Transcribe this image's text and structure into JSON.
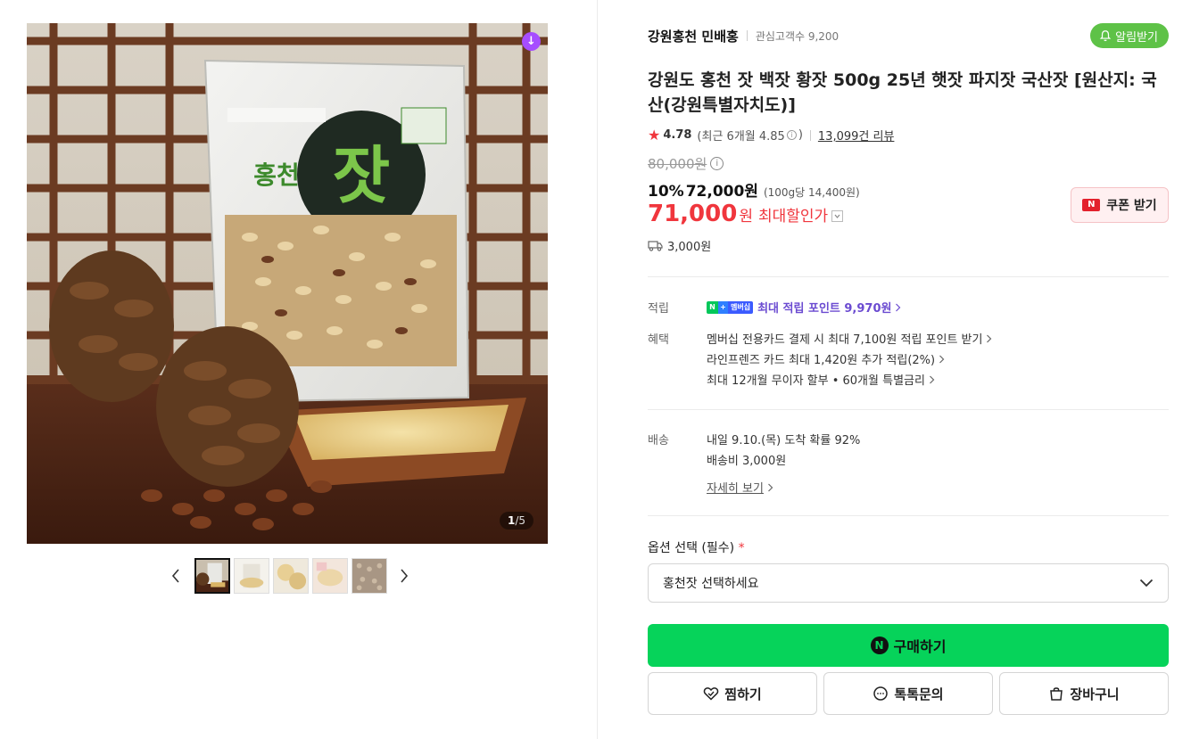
{
  "gallery": {
    "download_icon": "download-arrow-icon",
    "counter_current": "1",
    "counter_total": "/5",
    "thumbnails": [
      "thumb-1",
      "thumb-2",
      "thumb-3",
      "thumb-4",
      "thumb-5"
    ]
  },
  "seller": {
    "name": "강원홍천 민배홍",
    "followers": "관심고객수 9,200",
    "alarm_label": "알림받기"
  },
  "product": {
    "title": "강원도 홍천 잣 백잣 황잣 500g 25년 햇잣 파지잣 국산잣 [원산지: 국산(강원특별자치도)]",
    "rating": "4.78",
    "recent_rating_prefix": "(최근 6개월 4.85",
    "recent_rating_suffix": ")",
    "review_count": "13,099건 리뷰"
  },
  "price": {
    "original": "80,000원",
    "discount_pct": "10%",
    "discount_price": "72,000원",
    "unit_price": "(100g당 14,400원)",
    "max_price": "71,000",
    "max_won": "원",
    "max_label": "최대할인가",
    "coupon_label": "쿠폰 받기",
    "shipping": "3,000원"
  },
  "benefits": {
    "points_label": "적립",
    "points_badge_n": "N",
    "points_badge_plus": "+",
    "points_badge_member": "멤버십",
    "points_text": "최대 적립 포인트 9,970원",
    "benefit_label": "혜택",
    "benefit_lines": [
      "멤버십 전용카드 결제 시 최대 7,100원 적립 포인트 받기",
      "라인프렌즈 카드 최대 1,420원 추가 적립(2%)",
      "최대 12개월 무이자 할부 • 60개월 특별금리"
    ]
  },
  "delivery": {
    "label": "배송",
    "arrival": "내일 9.10.(목) 도착 확률 92%",
    "fee": "배송비 3,000원",
    "detail_link": "자세히 보기"
  },
  "options": {
    "label": "옵션 선택 (필수)",
    "required_mark": "*",
    "placeholder": "홍천잣 선택하세요"
  },
  "actions": {
    "buy_icon": "N",
    "buy": "구매하기",
    "wish": "찜하기",
    "talk": "톡톡문의",
    "cart": "장바구니"
  },
  "colors": {
    "accent_red": "#f0363d",
    "buy_green": "#06d35a",
    "alarm_green": "#5ec247",
    "points_purple": "#6b4bd1"
  }
}
